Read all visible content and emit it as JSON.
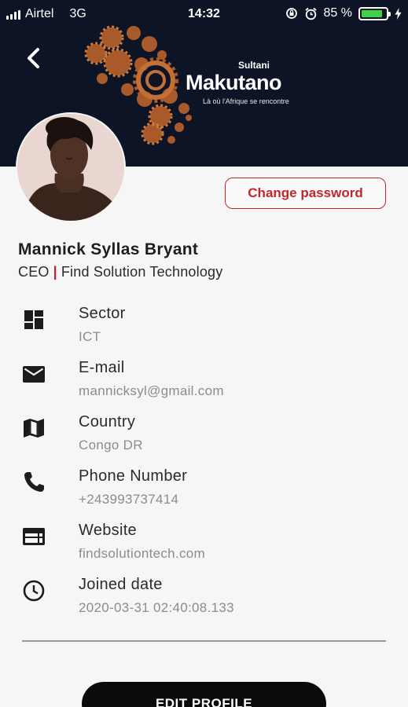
{
  "status_bar": {
    "carrier": "Airtel",
    "network": "3G",
    "time": "14:32",
    "battery_percent": "85 %",
    "battery_level": 0.85
  },
  "header": {
    "back_icon": "chevron-left-icon",
    "logo": {
      "small": "Sultani",
      "main": "Makutano",
      "tagline": "Là où l'Afrique se rencontre"
    },
    "colors": {
      "background": "#0d1426",
      "gear": "#b5652e"
    }
  },
  "profile": {
    "name": "Mannick Syllas Bryant",
    "role": "CEO",
    "separator": "|",
    "company": "Find Solution Technology",
    "change_password_label": "Change password"
  },
  "info": [
    {
      "icon": "dashboard-icon",
      "label": "Sector",
      "value": "ICT"
    },
    {
      "icon": "mail-icon",
      "label": "E-mail",
      "value": "mannicksyl@gmail.com"
    },
    {
      "icon": "map-icon",
      "label": "Country",
      "value": "Congo DR"
    },
    {
      "icon": "phone-icon",
      "label": "Phone Number",
      "value": "+243993737414"
    },
    {
      "icon": "web-icon",
      "label": "Website",
      "value": "findsolutiontech.com"
    },
    {
      "icon": "clock-icon",
      "label": "Joined date",
      "value": "2020-03-31 02:40:08.133"
    }
  ],
  "actions": {
    "edit_profile_label": "EDIT PROFILE"
  },
  "colors": {
    "accent": "#c0272d",
    "button_dark": "#0b0b0b",
    "battery_green": "#3fd14a"
  }
}
